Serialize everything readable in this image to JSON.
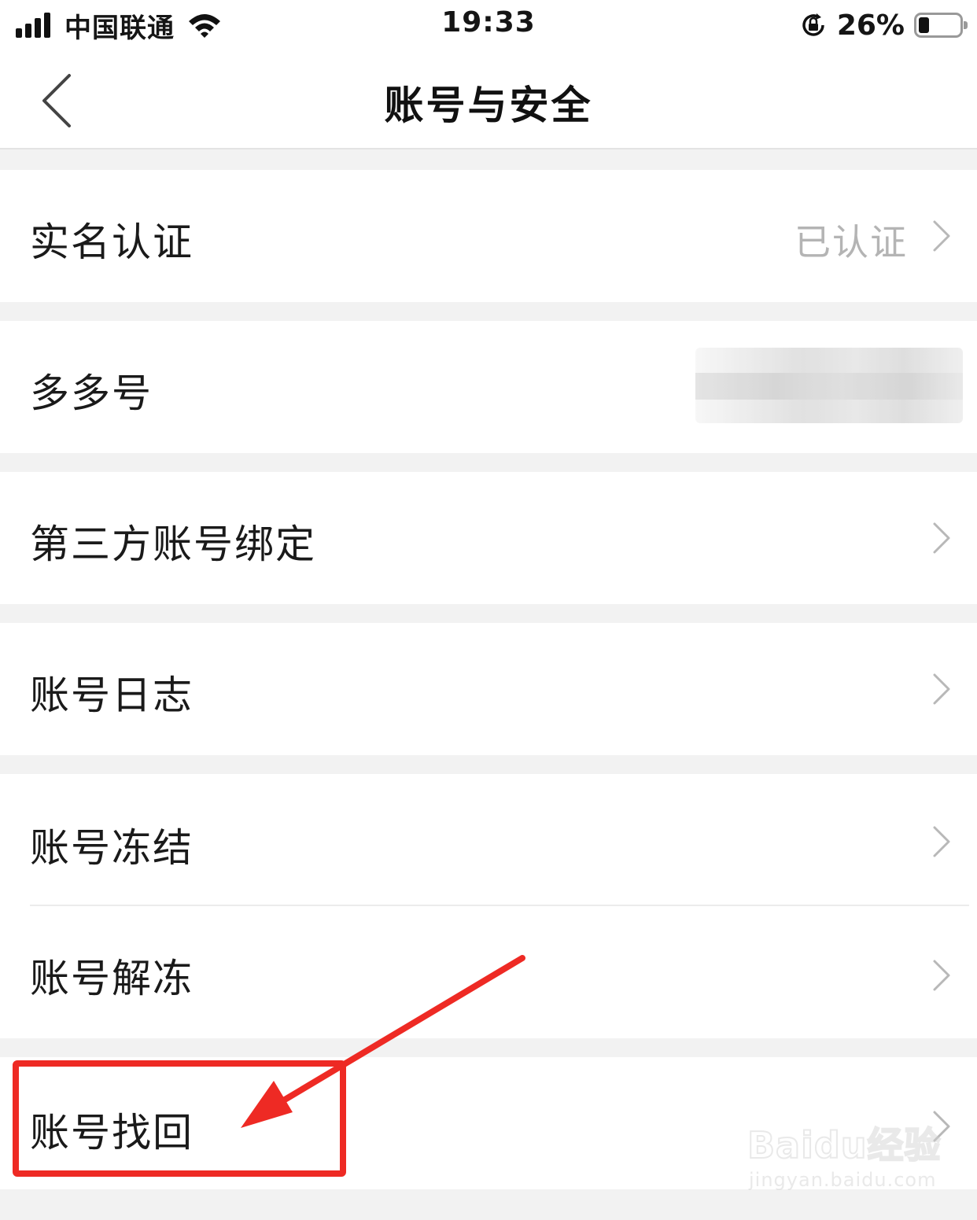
{
  "status_bar": {
    "carrier": "中国联通",
    "time": "19:33",
    "battery_percent": "26%",
    "battery_level": 0.26,
    "icons": [
      "signal-icon",
      "wifi-icon",
      "orientation-lock-icon",
      "battery-icon"
    ]
  },
  "nav": {
    "title": "账号与安全",
    "back_icon": "chevron-left-icon"
  },
  "rows": [
    {
      "label": "实名认证",
      "value": "已认证",
      "chevron": true
    },
    {
      "label": "多多号",
      "value_redacted": true,
      "chevron": false
    },
    {
      "label": "第三方账号绑定",
      "chevron": true
    },
    {
      "label": "账号日志",
      "chevron": true
    },
    {
      "label": "账号冻结",
      "chevron": true
    },
    {
      "label": "账号解冻",
      "chevron": true
    },
    {
      "label": "账号找回",
      "chevron": true
    }
  ],
  "annotation": {
    "highlight_color": "#ee2a24",
    "target": "账号找回"
  },
  "watermark": {
    "main": "Baidu经验",
    "sub": "jingyan.baidu.com"
  }
}
